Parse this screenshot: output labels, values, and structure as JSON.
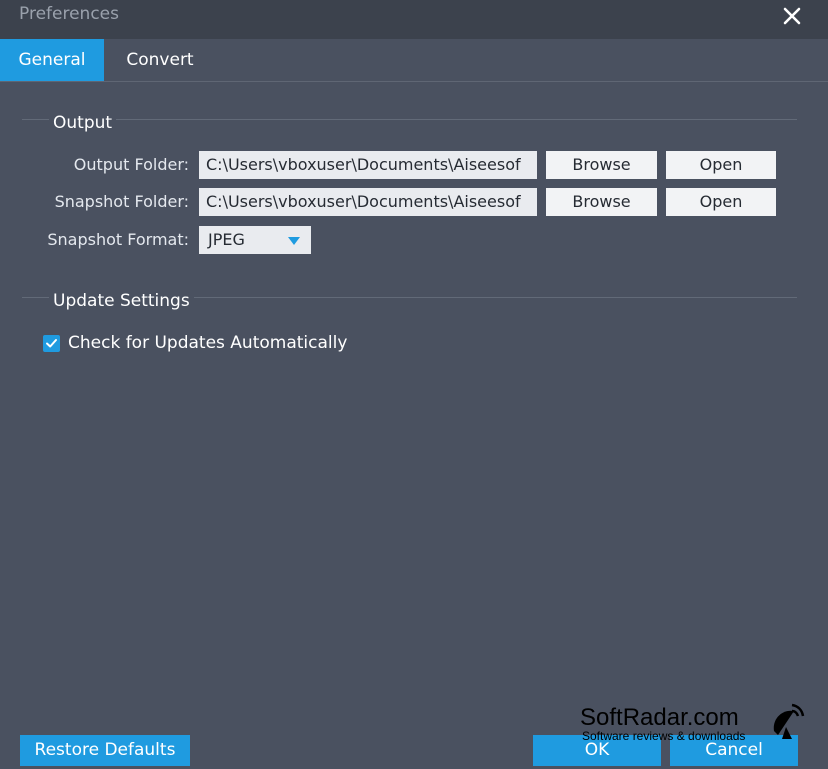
{
  "window": {
    "title": "Preferences",
    "close_icon": "close-icon"
  },
  "tabs": [
    {
      "label": "General",
      "active": true
    },
    {
      "label": "Convert",
      "active": false
    }
  ],
  "output": {
    "section_title": "Output",
    "output_folder_label": "Output Folder:",
    "output_folder_value": "C:\\Users\\vboxuser\\Documents\\Aiseesof",
    "snapshot_folder_label": "Snapshot Folder:",
    "snapshot_folder_value": "C:\\Users\\vboxuser\\Documents\\Aiseesof",
    "snapshot_format_label": "Snapshot Format:",
    "snapshot_format_value": "JPEG",
    "browse_label": "Browse",
    "open_label": "Open"
  },
  "update": {
    "section_title": "Update Settings",
    "check_label": "Check for Updates Automatically",
    "checked": true
  },
  "footer": {
    "restore_label": "Restore Defaults",
    "ok_label": "OK",
    "cancel_label": "Cancel"
  },
  "watermark": {
    "title": "SoftRadar.com",
    "subtitle": "Software reviews & downloads"
  },
  "colors": {
    "accent": "#1f9be0",
    "background": "#4a5160",
    "titlebar": "#3c424d"
  }
}
